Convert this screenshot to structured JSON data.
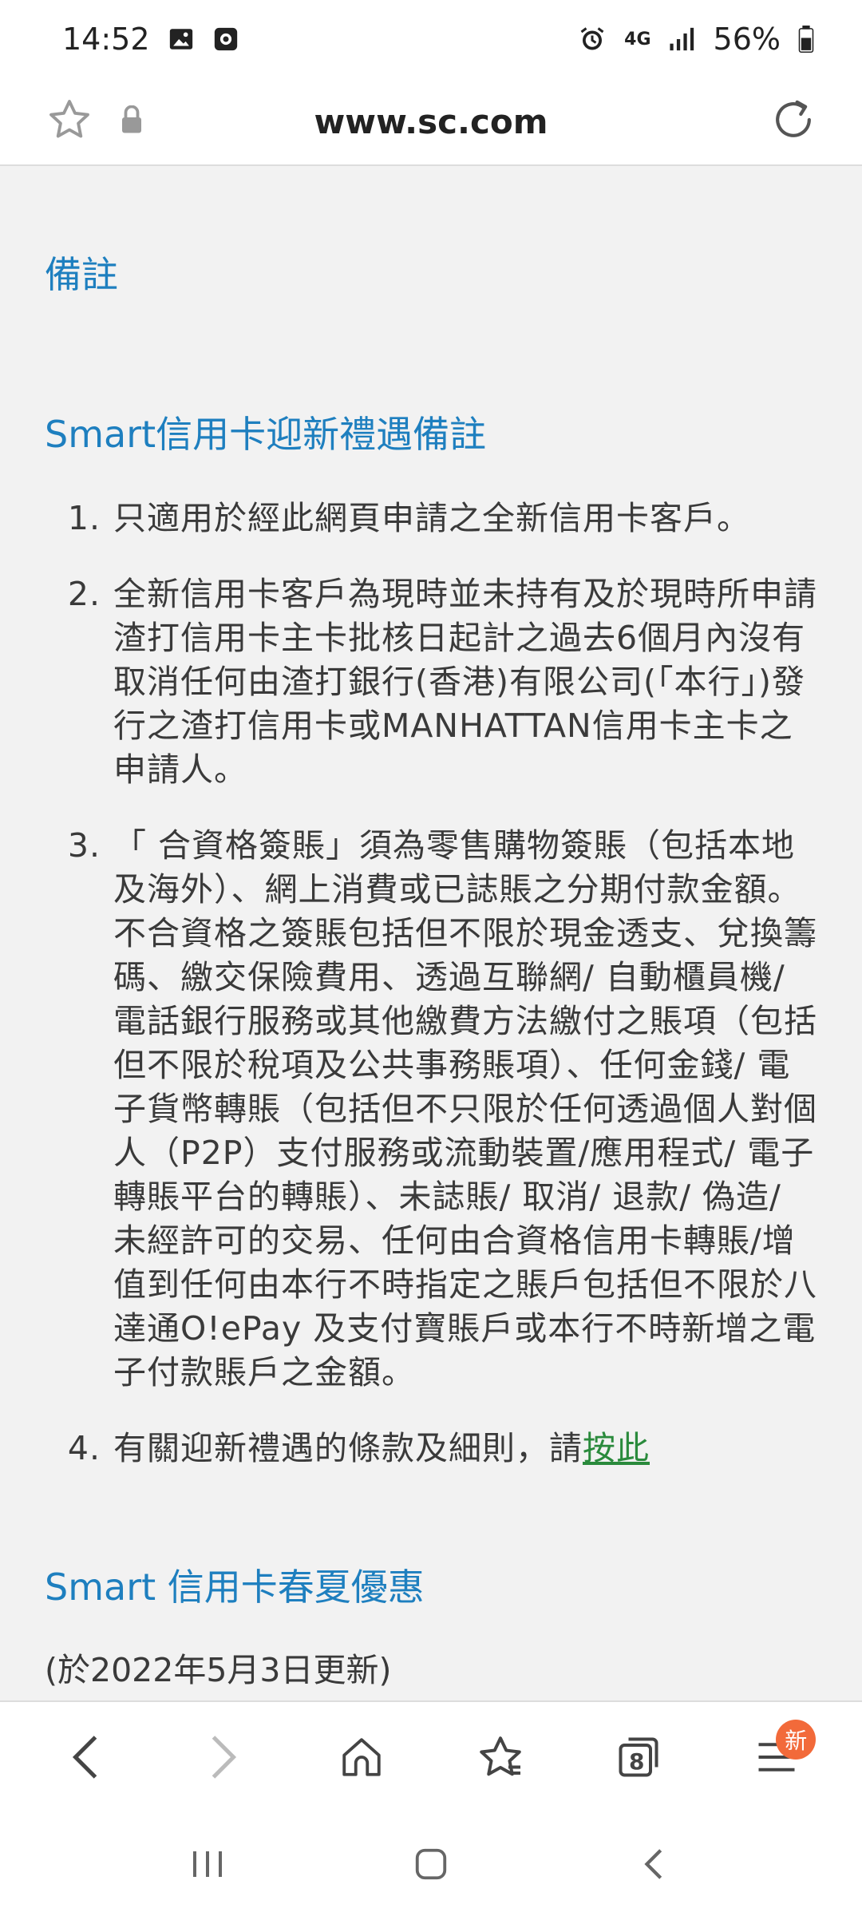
{
  "status": {
    "time": "14:52",
    "network": "4G",
    "battery": "56%"
  },
  "url_bar": {
    "url": "www.sc.com"
  },
  "content": {
    "notes_heading": "備註",
    "smart_heading": "Smart信用卡迎新禮遇備註",
    "items": [
      {
        "num": "1.",
        "text": "只適用於經此網頁申請之全新信用卡客戶。"
      },
      {
        "num": "2.",
        "text": "全新信用卡客戶為現時並未持有及於現時所申請渣打信用卡主卡批核日起計之過去6個月內沒有取消任何由渣打銀行(香港)有限公司(「本行」)發行之渣打信用卡或MANHATTAN信用卡主卡之申請人。"
      },
      {
        "num": "3.",
        "text": "「 合資格簽賬」須為零售購物簽賬（包括本地及海外）、網上消費或已誌賬之分期付款金額。不合資格之簽賬包括但不限於現金透支、兌換籌碼、繳交保險費用、透過互聯網/ 自動櫃員機/ 電話銀行服務或其他繳費方法繳付之賬項（包括但不限於稅項及公共事務賬項）、任何金錢/ 電子貨幣轉賬（包括但不只限於任何透過個人對個人（P2P）支付服務或流動裝置/應用程式/ 電子轉賬平台的轉賬）、未誌賬/ 取消/ 退款/ 偽造/ 未經許可的交易、任何由合資格信用卡轉賬/增值到任何由本行不時指定之賬戶包括但不限於八達通O!ePay 及支付寶賬戶或本行不時新增之電子付款賬戶之金額。"
      },
      {
        "num": "4.",
        "text": "有關迎新禮遇的條款及細則，請",
        "link": "按此"
      }
    ],
    "spring_heading": "Smart 信用卡春夏優惠",
    "update_note": "(於2022年5月3日更新)"
  },
  "toolbar": {
    "tabs_count": "8",
    "menu_badge": "新"
  },
  "colors": {
    "heading_blue": "#1e7fbf",
    "link_green": "#2a8a3c",
    "badge_orange": "#f26a3a",
    "content_bg": "#f2f2f2"
  }
}
